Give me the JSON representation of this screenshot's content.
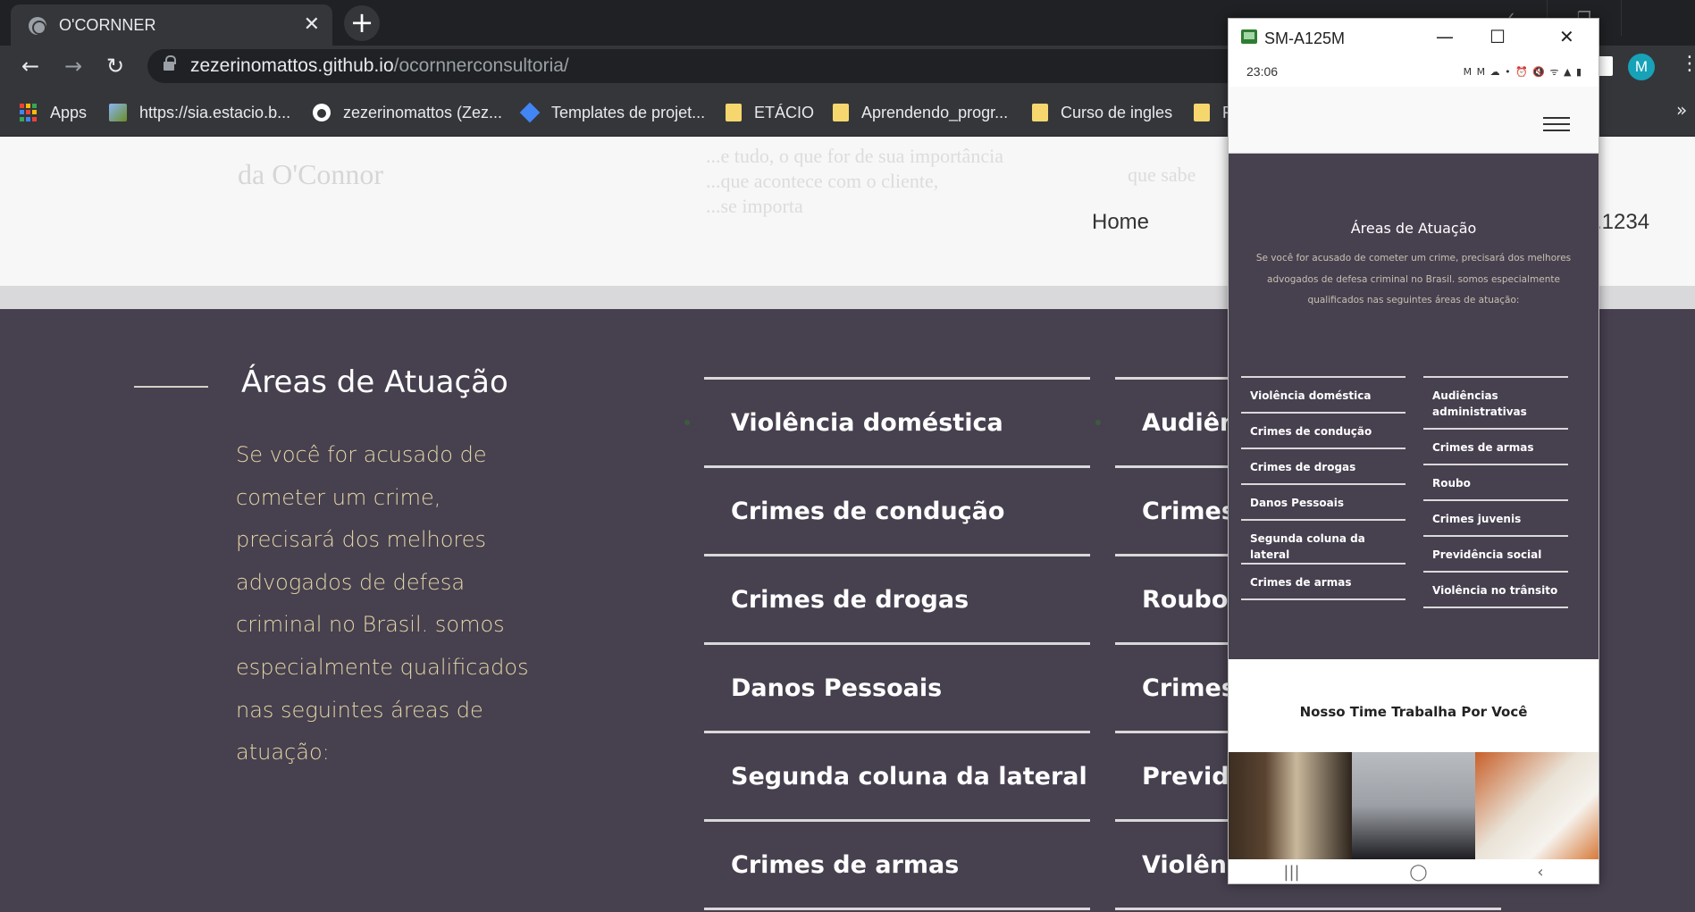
{
  "browser": {
    "tab_title": "O'CORNNER",
    "tab_close": "✕",
    "new_tab": "+",
    "url_host": "zezerinomattos.github.io",
    "url_path": "/ocornnerconsultoria/",
    "profile_initial": "M",
    "back": "←",
    "forward": "→",
    "reload": "↻",
    "menu": "⋮",
    "bookmarks": [
      {
        "label": "Apps",
        "icon": "apps-icon"
      },
      {
        "label": "https://sia.estacio.b...",
        "icon": "site-icon"
      },
      {
        "label": "zezerinomattos (Zez...",
        "icon": "github-icon"
      },
      {
        "label": "Templates de projet...",
        "icon": "diamond-icon"
      },
      {
        "label": "ETÁCIO",
        "icon": "folder-icon"
      },
      {
        "label": "Aprendendo_progr...",
        "icon": "folder-icon"
      },
      {
        "label": "Curso de ingles",
        "icon": "folder-icon"
      },
      {
        "label": "F",
        "icon": "folder-icon"
      }
    ],
    "bookmarks_more": "»"
  },
  "site": {
    "ghost_brand": "da O'Connor",
    "ghost_text_1": "...e tudo, o que for de sua importância\n...que acontece com o cliente,\n...se importa",
    "ghost_text_2": "que sabe",
    "nav_home": "Home",
    "nav_phone": ".1234",
    "areas": {
      "title": "Áreas de Atuação",
      "lead": "Se você for acusado de cometer um crime, precisará dos melhores advogados de defesa criminal no Brasil. somos especialmente qualificados nas seguintes áreas de atuação:",
      "col1": [
        "Violência doméstica",
        "Crimes de condução",
        "Crimes de drogas",
        "Danos Pessoais",
        "Segunda coluna da lateral",
        "Crimes de armas"
      ],
      "col2": [
        "Audiênc",
        "Crimes",
        "Roubo",
        "Crimes",
        "Previdê",
        "Violênci"
      ]
    }
  },
  "phone": {
    "window_title": "SM-A125M",
    "minimize": "—",
    "maximize": "☐",
    "close": "✕",
    "time": "23:06",
    "status_icons": "M M ☁ •  ⏰ 🔇 ᯤ ▲ ▮",
    "areas_title": "Áreas de Atuação",
    "areas_lead": "Se você for acusado de cometer um crime, precisará dos melhores advogados de defesa criminal no Brasil. somos especialmente qualificados nas seguintes áreas de atuação:",
    "left_items": [
      "Violência doméstica",
      "Crimes de condução",
      "Crimes de drogas",
      "Danos Pessoais",
      "Segunda coluna da lateral",
      "Crimes de armas"
    ],
    "right_items": [
      "Audiências administrativas",
      "Crimes de armas",
      "Roubo",
      "Crimes juvenis",
      "Previdência social",
      "Violência no trânsito"
    ],
    "team_title": "Nosso Time Trabalha Por Você",
    "nav_recent": "|||",
    "nav_home": "◯",
    "nav_back": "‹"
  }
}
